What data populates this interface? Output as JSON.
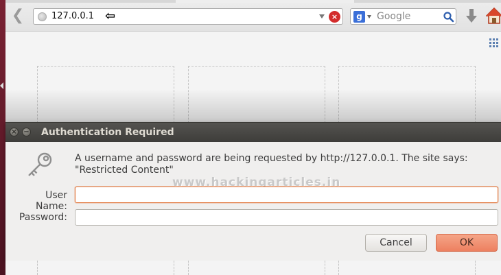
{
  "toolbar": {
    "url": "127.0.0.1",
    "search_placeholder": "Google",
    "search_engine_letter": "g"
  },
  "dialog": {
    "title": "Authentication Required",
    "message": "A username and password are being requested by http://127.0.0.1. The site says: \"Restricted Content\"",
    "username_label": "User Name:",
    "password_label": "Password:",
    "username_value": "",
    "password_value": "",
    "cancel_label": "Cancel",
    "ok_label": "OK",
    "close_glyph": "×",
    "minimize_glyph": "−"
  },
  "watermark": "www.hackingarticles.in",
  "colors": {
    "titlebar": "#3e3d3a",
    "ok_button": "#ed8060",
    "focus_border": "#e0753a",
    "stop_button": "#d32d2d"
  },
  "icons": {
    "back": "back-arrow-icon",
    "globe": "globe-icon",
    "stop": "stop-icon",
    "search": "magnifier-icon",
    "download": "download-icon",
    "home": "home-icon",
    "grid": "grid-icon",
    "key": "key-icon"
  }
}
